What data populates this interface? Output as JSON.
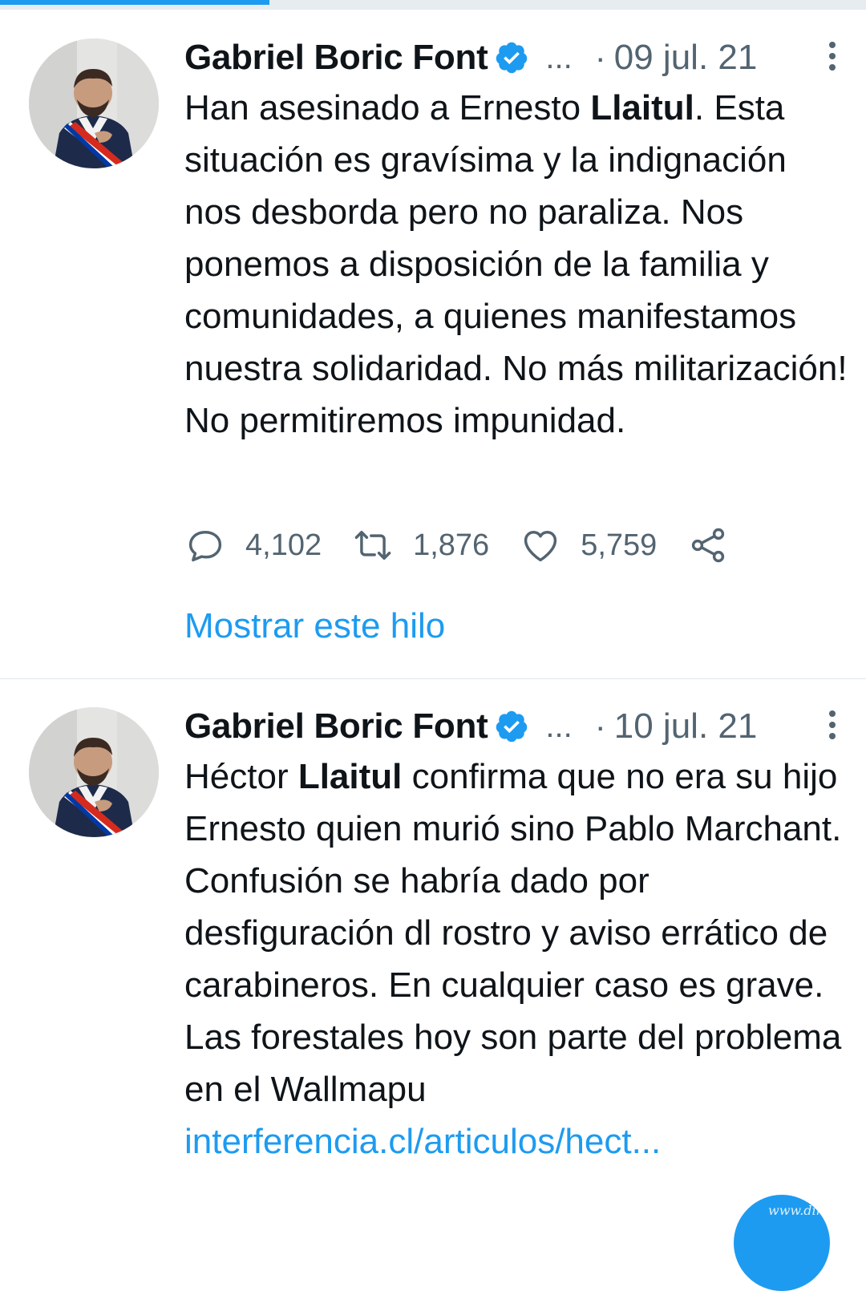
{
  "tweets": [
    {
      "author": "Gabriel Boric Font",
      "verified": true,
      "ellipsis": "...",
      "dot": "·",
      "date": "09 jul. 21",
      "text_parts": [
        "Han asesinado a Ernesto ",
        "Llaitul",
        ". Esta situación es gravísima y la indignación nos desborda pero no paraliza. Nos ponemos a disposición de la familia y comunidades, a quienes manifestamos nuestra solidaridad. No más militarización! No permitiremos impunidad."
      ],
      "reply_count": "4,102",
      "retweet_count": "1,876",
      "like_count": "5,759",
      "show_thread": "Mostrar este hilo"
    },
    {
      "author": "Gabriel Boric Font",
      "verified": true,
      "ellipsis": "...",
      "dot": "·",
      "date": "10 jul. 21",
      "text_parts": [
        "Héctor ",
        "Llaitul",
        " confirma que no era su hijo Ernesto quien murió sino Pablo Marchant. Confusión se habría dado por desfiguración dl rostro y aviso errático de carabineros. En cualquier caso es grave. Las forestales hoy son parte del problema en el Wallmapu"
      ],
      "link": "interferencia.cl/articulos/hect..."
    }
  ],
  "watermark": "www.dinifino.cl",
  "colors": {
    "accent": "#1d9bf0",
    "text": "#0f1419",
    "muted": "#536471"
  },
  "icons": {
    "reply": "reply-icon",
    "retweet": "retweet-icon",
    "like": "heart-icon",
    "share": "share-icon",
    "verified": "verified-badge-icon",
    "more": "more-vertical-icon"
  }
}
